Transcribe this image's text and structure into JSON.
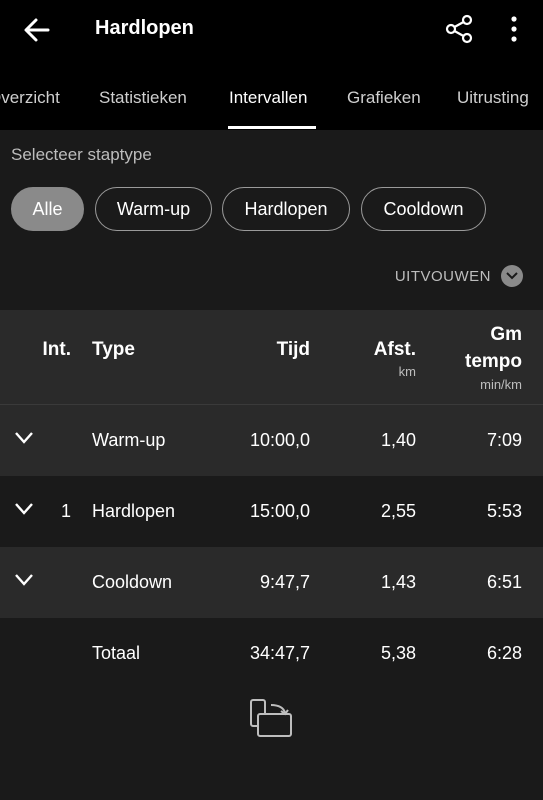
{
  "header": {
    "title": "Hardlopen"
  },
  "tabs": [
    {
      "label": "Overzicht"
    },
    {
      "label": "Statistieken"
    },
    {
      "label": "Intervallen"
    },
    {
      "label": "Grafieken"
    },
    {
      "label": "Uitrusting"
    }
  ],
  "filter": {
    "label": "Selecteer staptype",
    "chips": [
      {
        "label": "Alle"
      },
      {
        "label": "Warm-up"
      },
      {
        "label": "Hardlopen"
      },
      {
        "label": "Cooldown"
      }
    ],
    "expand_label": "UITVOUWEN"
  },
  "table": {
    "headers": {
      "int": "Int.",
      "type": "Type",
      "tijd": "Tijd",
      "afst": "Afst.",
      "afst_unit": "km",
      "tempo_line1": "Gm",
      "tempo_line2": "tempo",
      "tempo_unit": "min/km"
    },
    "rows": [
      {
        "int": "",
        "type": "Warm-up",
        "tijd": "10:00,0",
        "afst": "1,40",
        "tempo": "7:09"
      },
      {
        "int": "1",
        "type": "Hardlopen",
        "tijd": "15:00,0",
        "afst": "2,55",
        "tempo": "5:53"
      },
      {
        "int": "",
        "type": "Cooldown",
        "tijd": "9:47,7",
        "afst": "1,43",
        "tempo": "6:51"
      }
    ],
    "total": {
      "type": "Totaal",
      "tijd": "34:47,7",
      "afst": "5,38",
      "tempo": "6:28"
    }
  },
  "icons": {
    "back": "arrow-left-icon",
    "share": "share-icon",
    "more": "more-vertical-icon",
    "expand": "chevron-down-icon",
    "row_expand": "chevron-down-icon",
    "rotate": "screen-rotate-icon"
  }
}
